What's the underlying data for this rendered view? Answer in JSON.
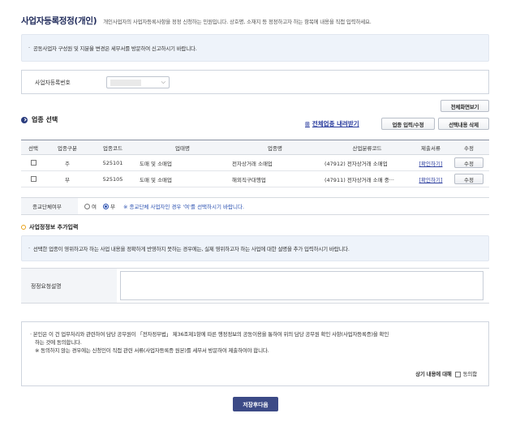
{
  "header": {
    "title": "사업자등록정정(개인)",
    "description": "개인사업자의 사업자등록사항을 정정 신청하는 민원입니다. 상호명, 소재지 등 정정하고자 하는 항목에 내용을 직접 입력하세요."
  },
  "notice1": {
    "text": "공동사업자 구성원 및 지분율 변경은 세무서를 방문하여 신고하시기 바랍니다."
  },
  "regno": {
    "label": "사업자등록번호",
    "value": ""
  },
  "buttons": {
    "fullscreen": "전체화면보기",
    "industry_input": "업종 입력/수정",
    "delete_selected": "선택내용 삭제",
    "save_next": "저장후다음"
  },
  "industry": {
    "title": "업종 선택",
    "download_link": "전체업종 내려받기",
    "columns": [
      "선택",
      "업종구분",
      "업종코드",
      "업태명",
      "업종명",
      "산업분류코드",
      "제출서류",
      "수정"
    ],
    "rows": [
      {
        "type": "주",
        "code": "525101",
        "business": "도매 및 소매업",
        "item": "전자상거래 소매업",
        "class_code": "(47912) 전자상거래 소매업",
        "docs": "[확인하기]",
        "edit": "수정"
      },
      {
        "type": "부",
        "code": "525105",
        "business": "도매 및 소매업",
        "item": "해외직구대행업",
        "class_code": "(47911) 전자상거래 소매 중···",
        "docs": "[확인하기]",
        "edit": "수정"
      }
    ]
  },
  "closing": {
    "label": "종교단체여부",
    "option_yes": "여",
    "option_no": "부",
    "selected": "부",
    "note": "※ 종교단체 사업자인 경우 '여'를 선택하시기 바랍니다."
  },
  "extra": {
    "title": "사업정정보 추가입력",
    "notice": "선택한 업종이 영위하고자 하는 사업 내용을 정확하게 반영하지 못하는 경우에는, 실제 영위하고자 하는 사업에 대한 설명을 추가 입력하시기 바랍니다.",
    "reason_label": "정정요청설명",
    "reason_value": ""
  },
  "consent": {
    "line1": "본인은 이 건 업무처리와 관련하여 담당 공무원이 「전자정부법」 제36조제1항에 따른 행정정보의 공동이용을 통하여 위의 담당 공무원 확인 사항(사업자등록증)을 확인",
    "line2": "하는 것에 동의합니다.",
    "line3": "※ 동의하지 않는 경우에는 신청인이 직접 관련 서류(사업자등록증 원본)를 세무서 방문하여 제출하여야 합니다.",
    "agree_label": "상기 내용에 대해",
    "agree_check": "동의함"
  },
  "colors": {
    "primary": "#3c4a86",
    "link": "#2a3c9e",
    "notice_bg": "#eef3fa",
    "accent_ring": "#e8a21a"
  }
}
